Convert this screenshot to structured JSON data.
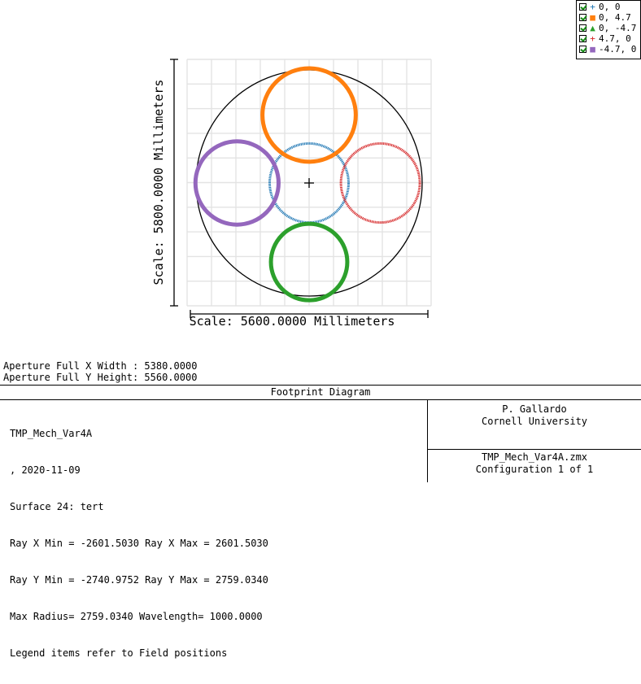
{
  "chart_data": {
    "type": "scatter",
    "plot_kind": "footprint diagram",
    "x_scale_label": "Scale: 5600.0000 Millimeters",
    "y_scale_label": "Scale: 5800.0000 Millimeters",
    "grid": true,
    "legend_position": "top-right",
    "aperture": {
      "type": "circle",
      "full_x_width_mm": 5380.0,
      "full_y_height_mm": 5560.0
    },
    "series": [
      {
        "name": "0, 0",
        "marker": "plus",
        "color": "#1f77b4",
        "center_mm": [
          0,
          0
        ],
        "radius_mm": 930
      },
      {
        "name": "0, 4.7",
        "marker": "square",
        "color": "#ff7f0e",
        "center_mm": [
          0,
          1600
        ],
        "radius_mm": 1100
      },
      {
        "name": "0, -4.7",
        "marker": "triangle",
        "color": "#2ca02c",
        "center_mm": [
          0,
          -1860
        ],
        "radius_mm": 900
      },
      {
        "name": "4.7, 0",
        "marker": "plus",
        "color": "#d62728",
        "center_mm": [
          1680,
          0
        ],
        "radius_mm": 930
      },
      {
        "name": "-4.7, 0",
        "marker": "square",
        "color": "#9467bd",
        "center_mm": [
          -1700,
          0
        ],
        "radius_mm": 980
      }
    ]
  },
  "aperture_text": {
    "x_width": "Aperture Full X Width : 5380.0000",
    "y_height": "Aperture Full Y Height: 5560.0000"
  },
  "info": {
    "title": "Footprint Diagram",
    "lines": [
      "TMP_Mech_Var4A",
      ", 2020-11-09",
      "Surface 24: tert",
      "Ray X Min = -2601.5030 Ray X Max = 2601.5030",
      "Ray Y Min = -2740.9752 Ray Y Max = 2759.0340",
      "Max Radius= 2759.0340 Wavelength= 1000.0000",
      "Legend items refer to Field positions"
    ],
    "author": "P. Gallardo",
    "organization": "Cornell University",
    "file": "TMP_Mech_Var4A.zmx",
    "configuration": "Configuration 1 of 1"
  }
}
